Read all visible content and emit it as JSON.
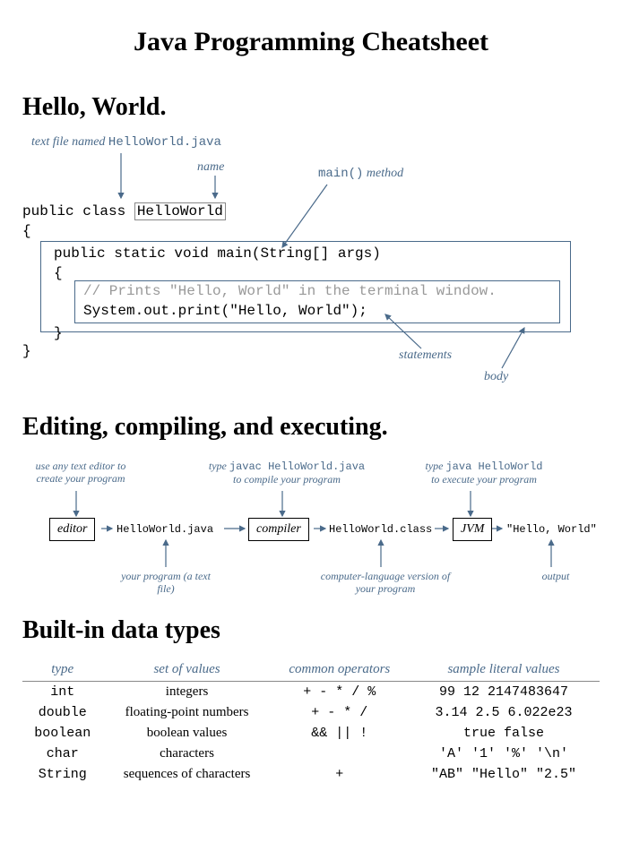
{
  "title": "Java Programming Cheatsheet",
  "section1": {
    "heading": "Hello, World.",
    "ann_textfile": "text file named",
    "ann_textfile_mono": "HelloWorld.java",
    "ann_name": "name",
    "ann_mainmethod": "main() method",
    "ann_mainmethod_mono": "main()",
    "ann_statements": "statements",
    "ann_body": "body",
    "code_line1a": "public class ",
    "code_line1b": "HelloWorld",
    "code_line2": "{",
    "code_line3": "public static void main(String[] args)",
    "code_line4": "{",
    "code_line5": "// Prints \"Hello, World\" in the terminal window.",
    "code_line6": "System.out.print(\"Hello, World\");",
    "code_line7": "}",
    "code_line8": "}"
  },
  "section2": {
    "heading": "Editing, compiling, and executing.",
    "ann_editor_top": "use any text editor to create your program",
    "ann_compiler_top_a": "type",
    "ann_compiler_top_mono": "javac HelloWorld.java",
    "ann_compiler_top_b": "to compile your program",
    "ann_jvm_top_a": "type",
    "ann_jvm_top_mono": "java HelloWorld",
    "ann_jvm_top_b": "to execute your program",
    "box_editor": "editor",
    "box_compiler": "compiler",
    "box_jvm": "JVM",
    "txt_source": "HelloWorld.java",
    "txt_class": "HelloWorld.class",
    "txt_output": "\"Hello, World\"",
    "ann_source_bot": "your program (a text file)",
    "ann_class_bot": "computer-language version of your program",
    "ann_output_bot": "output"
  },
  "section3": {
    "heading": "Built-in data types",
    "headers": [
      "type",
      "set of values",
      "common operators",
      "sample literal values"
    ],
    "rows": [
      {
        "type": "int",
        "set": "integers",
        "ops": "+ - * / %",
        "lits": "99 12 2147483647"
      },
      {
        "type": "double",
        "set": "floating-point numbers",
        "ops": "+ - * /",
        "lits": "3.14 2.5 6.022e23"
      },
      {
        "type": "boolean",
        "set": "boolean values",
        "ops": "&& || !",
        "lits": "true false"
      },
      {
        "type": "char",
        "set": "characters",
        "ops": "",
        "lits": "'A' '1' '%' '\\n'"
      },
      {
        "type": "String",
        "set": "sequences of characters",
        "ops": "+",
        "lits": "\"AB\" \"Hello\" \"2.5\""
      }
    ]
  }
}
